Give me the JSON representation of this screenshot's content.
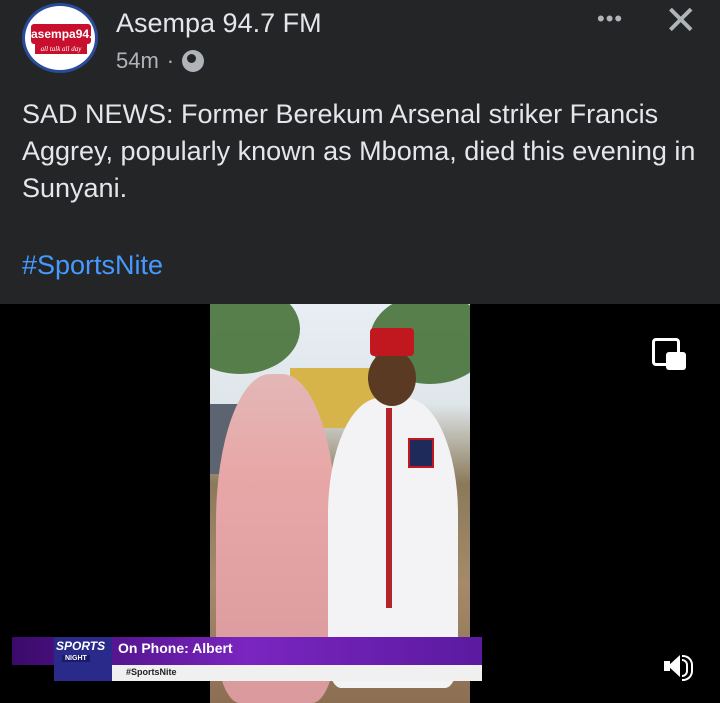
{
  "post": {
    "page_name": "Asempa 94.7 FM",
    "time": "54m",
    "separator": "·",
    "text": "SAD NEWS: Former Berekum Arsenal striker Francis Aggrey, popularly known as Mboma, died this evening in Sunyani.",
    "hashtag": "#SportsNite",
    "avatar": {
      "logo_text": "asempa94.",
      "logo_sub": "all talk all day"
    },
    "more_icon": "more-horizontal-icon",
    "close_icon": "close-icon",
    "privacy_icon": "globe-icon"
  },
  "video": {
    "banner": {
      "show_top": "SPORTS",
      "show_bottom": "NIGHT",
      "on_phone": "On Phone: Albert",
      "tag": "#SportsNite"
    },
    "pip_icon": "picture-in-picture-icon",
    "volume_icon": "volume-icon"
  },
  "colors": {
    "background": "#242526",
    "text": "#e4e6eb",
    "muted": "#b0b3b8",
    "link": "#4599ff"
  }
}
